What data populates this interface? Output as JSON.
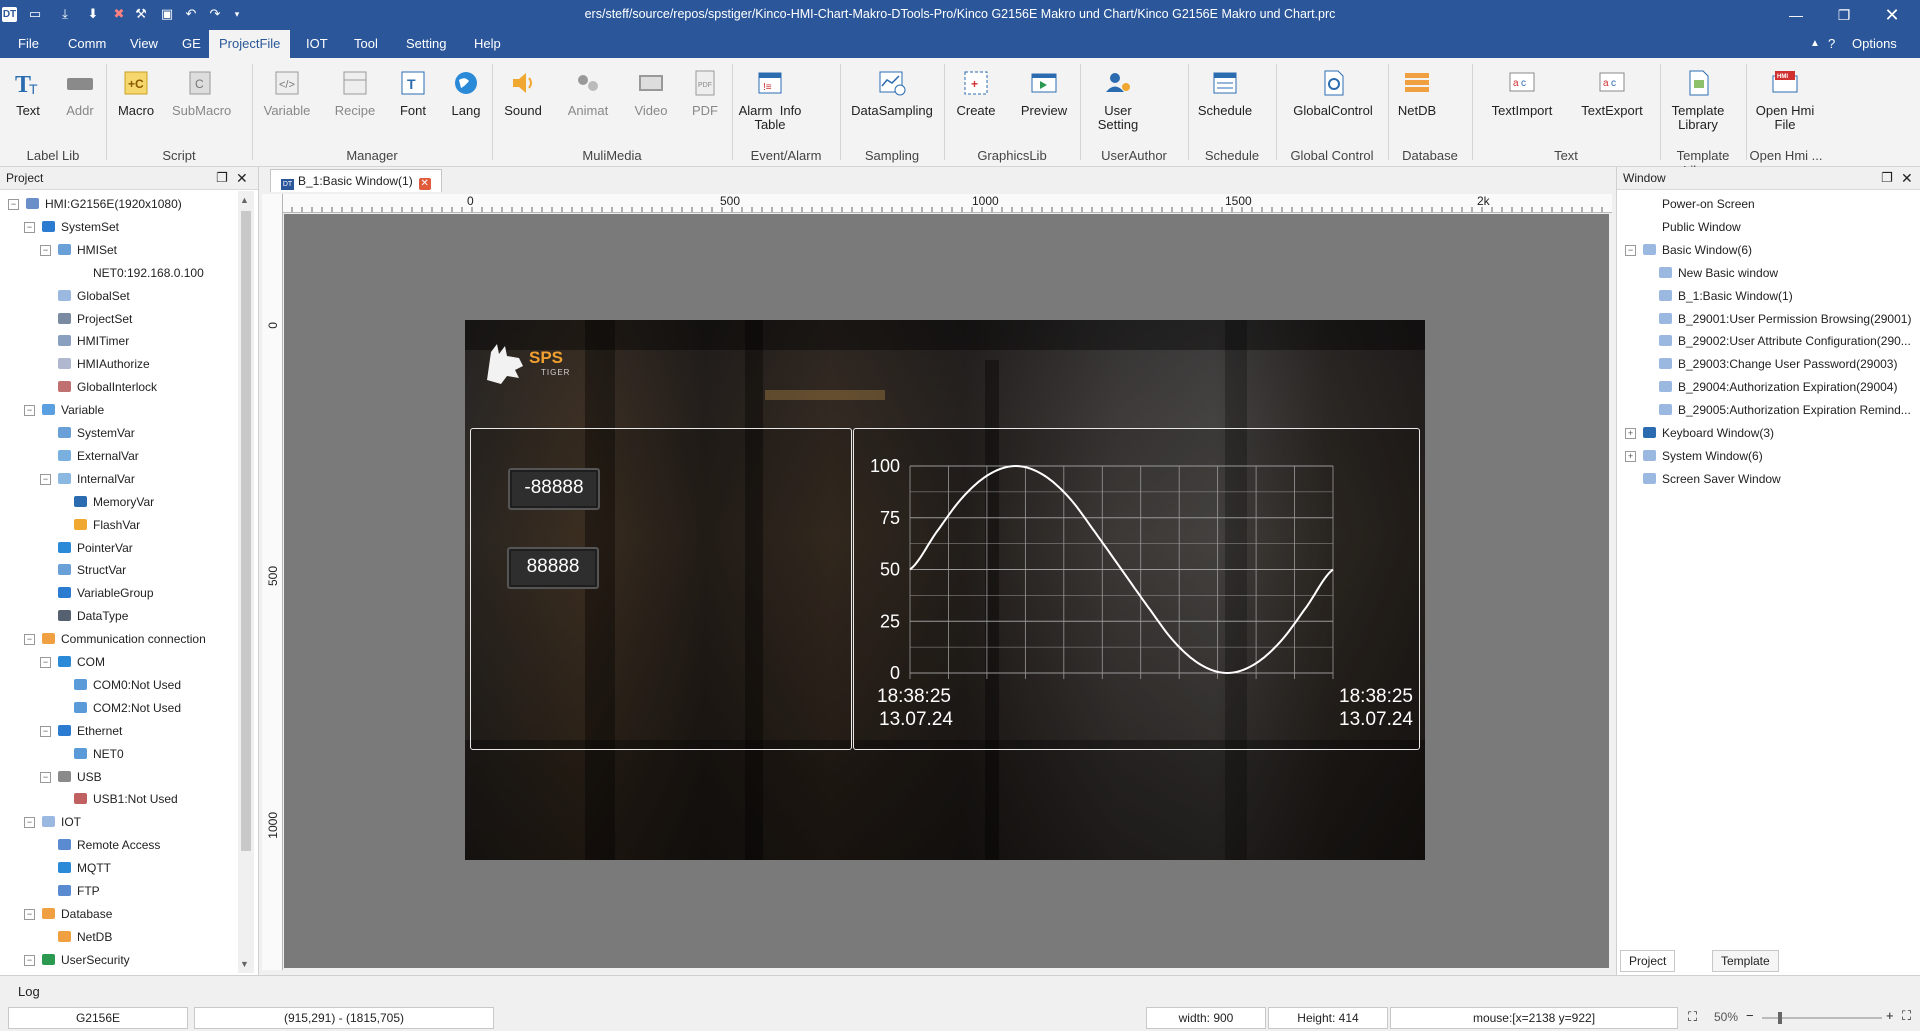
{
  "titlebar": {
    "title": "ers/steff/source/repos/spstiger/Kinco-HMI-Chart-Makro-DTools-Pro/Kinco G2156E Makro und Chart/Kinco G2156E Makro und Chart.prc"
  },
  "menu": {
    "items": [
      "File",
      "Comm",
      "View",
      "GE",
      "ProjectFile",
      "IOT",
      "Tool",
      "Setting",
      "Help"
    ],
    "active": "ProjectFile",
    "options": "Options"
  },
  "ribbon": {
    "buttons": [
      {
        "label": "Text"
      },
      {
        "label": "Addr"
      },
      {
        "label": "Macro"
      },
      {
        "label": "SubMacro"
      },
      {
        "label": "Variable"
      },
      {
        "label": "Recipe"
      },
      {
        "label": "Font"
      },
      {
        "label": "Lang"
      },
      {
        "label": "Sound"
      },
      {
        "label": "Animat"
      },
      {
        "label": "Video"
      },
      {
        "label": "PDF"
      },
      {
        "label": "Alarm  Info\nTable"
      },
      {
        "label": "DataSampling"
      },
      {
        "label": "Create"
      },
      {
        "label": "Preview"
      },
      {
        "label": "User\nSetting"
      },
      {
        "label": "Schedule"
      },
      {
        "label": "GlobalControl"
      },
      {
        "label": "NetDB"
      },
      {
        "label": "TextImport"
      },
      {
        "label": "TextExport"
      },
      {
        "label": "Template\nLibrary"
      },
      {
        "label": "Open Hmi\nFile"
      }
    ],
    "groups": [
      "Label Lib",
      "Script",
      "Manager",
      "MuliMedia",
      "Event/Alarm",
      "Sampling",
      "GraphicsLib",
      "UserAuthor",
      "Schedule",
      "Global Control",
      "Database",
      "Text",
      "Template Libra...",
      "Open Hmi ..."
    ]
  },
  "project_panel": {
    "title": "Project",
    "tree": [
      {
        "label": "HMI:G2156E(1920x1080)"
      },
      {
        "label": "SystemSet"
      },
      {
        "label": "HMISet"
      },
      {
        "label": "NET0:192.168.0.100"
      },
      {
        "label": "GlobalSet"
      },
      {
        "label": "ProjectSet"
      },
      {
        "label": "HMITimer"
      },
      {
        "label": "HMIAuthorize"
      },
      {
        "label": "GlobalInterlock"
      },
      {
        "label": "Variable"
      },
      {
        "label": "SystemVar"
      },
      {
        "label": "ExternalVar"
      },
      {
        "label": "InternalVar"
      },
      {
        "label": "MemoryVar"
      },
      {
        "label": "FlashVar"
      },
      {
        "label": "PointerVar"
      },
      {
        "label": "StructVar"
      },
      {
        "label": "VariableGroup"
      },
      {
        "label": "DataType"
      },
      {
        "label": "Communication connection"
      },
      {
        "label": "COM"
      },
      {
        "label": "COM0:Not Used"
      },
      {
        "label": "COM2:Not Used"
      },
      {
        "label": "Ethernet"
      },
      {
        "label": "NET0"
      },
      {
        "label": "USB"
      },
      {
        "label": "USB1:Not Used"
      },
      {
        "label": "IOT"
      },
      {
        "label": "Remote Access"
      },
      {
        "label": "MQTT"
      },
      {
        "label": "FTP"
      },
      {
        "label": "Database"
      },
      {
        "label": "NetDB"
      },
      {
        "label": "UserSecurity"
      }
    ]
  },
  "editor": {
    "tab_label": "B_1:Basic Window(1)",
    "ruler_labels": [
      "0",
      "500",
      "1000",
      "1500",
      "2k"
    ],
    "vruler_labels": [
      "0",
      "500",
      "1000"
    ]
  },
  "hmi_screen": {
    "logo_text": "SPS",
    "logo_sub": "TIGER",
    "value_negative": "-88888",
    "value_positive": "88888",
    "chart_time_left": "18:38:25",
    "chart_date_left": "13.07.24",
    "chart_time_right": "18:38:25",
    "chart_date_right": "13.07.24"
  },
  "chart_data": {
    "type": "line",
    "title": "",
    "xlabel": "",
    "ylabel": "",
    "ylim": [
      0,
      100
    ],
    "yticks": [
      0,
      25,
      50,
      75,
      100
    ],
    "grid": true,
    "series": [
      {
        "values": [
          50,
          68,
          85,
          96,
          100,
          96,
          85,
          68,
          50,
          32,
          15,
          4,
          0,
          4,
          15,
          32,
          50
        ]
      }
    ],
    "colors": {
      "line": "#ffffff",
      "grid": "#9a9a9a",
      "text": "#ffffff"
    }
  },
  "window_panel": {
    "title": "Window",
    "tree": [
      {
        "label": "Power-on Screen"
      },
      {
        "label": "Public Window"
      },
      {
        "label": "Basic Window(6)"
      },
      {
        "label": "New Basic window"
      },
      {
        "label": "B_1:Basic Window(1)"
      },
      {
        "label": "B_29001:User Permission Browsing(29001)"
      },
      {
        "label": "B_29002:User Attribute Configuration(290..."
      },
      {
        "label": "B_29003:Change User Password(29003)"
      },
      {
        "label": "B_29004:Authorization Expiration(29004)"
      },
      {
        "label": "B_29005:Authorization Expiration Remind..."
      },
      {
        "label": "Keyboard Window(3)"
      },
      {
        "label": "System Window(6)"
      },
      {
        "label": "Screen Saver Window"
      }
    ],
    "bottom_tabs": [
      "Project tree",
      "Template Library"
    ]
  },
  "log": {
    "label": "Log"
  },
  "status": {
    "model": "G2156E",
    "coords": "(915,291) - (1815,705)",
    "width": "width: 900",
    "height": "Height: 414",
    "mouse": "mouse:[x=2138  y=922]",
    "zoom": "50%"
  },
  "colors": {
    "accent": "#2b579a"
  }
}
